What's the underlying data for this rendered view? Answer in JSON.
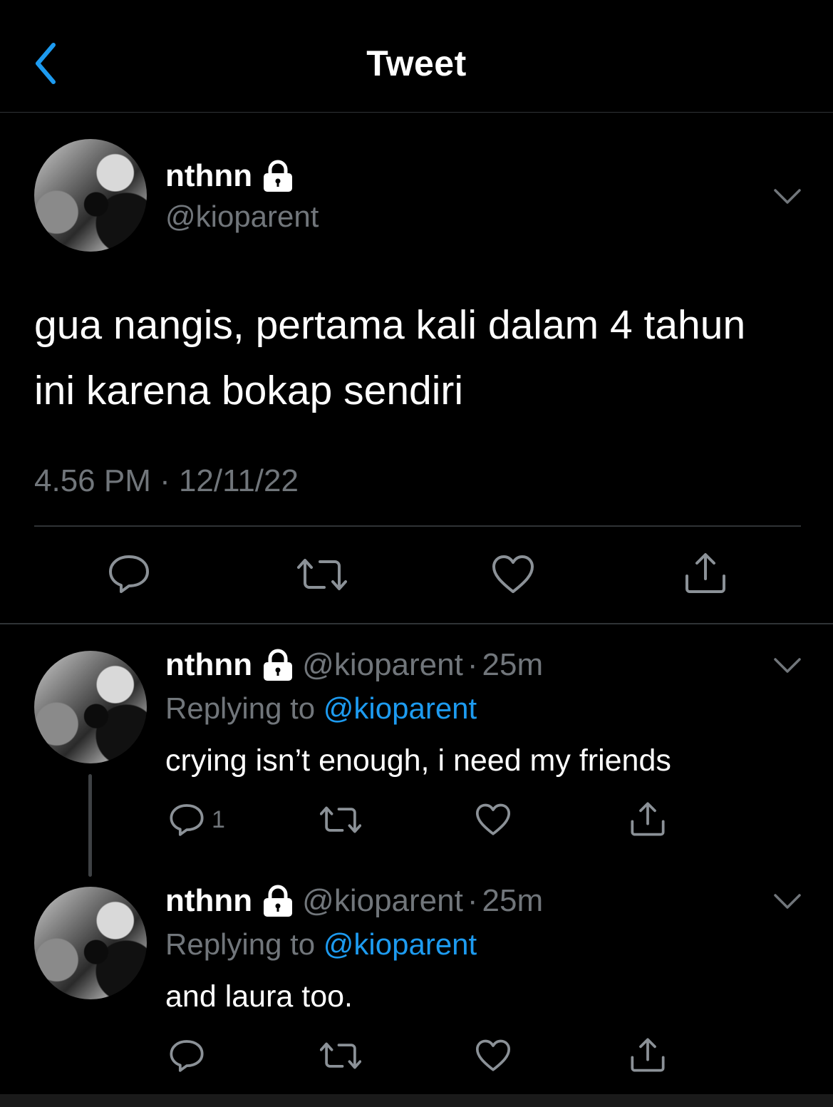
{
  "header": {
    "title": "Tweet"
  },
  "colors": {
    "background": "#000000",
    "accent": "#1d9bf0",
    "secondary_text": "#71767b",
    "divider": "#2f3336"
  },
  "main_tweet": {
    "display_name": "nthnn",
    "handle": "@kioparent",
    "text": "gua nangis, pertama kali dalam 4 tahun ini karena bokap sendiri",
    "timestamp": "4.56 PM · 12/11/22",
    "icons": [
      "lock-icon",
      "chevron-down-icon",
      "reply-icon",
      "retweet-icon",
      "like-icon",
      "share-icon"
    ]
  },
  "replies": [
    {
      "display_name": "nthnn",
      "handle": "@kioparent",
      "separator": "·",
      "time": "25m",
      "replying_prefix": "Replying to",
      "replying_to": "@kioparent",
      "text": "crying isn’t enough, i need my friends",
      "reply_count": "1"
    },
    {
      "display_name": "nthnn",
      "handle": "@kioparent",
      "separator": "·",
      "time": "25m",
      "replying_prefix": "Replying to",
      "replying_to": "@kioparent",
      "text": "and laura too.",
      "reply_count": ""
    }
  ]
}
